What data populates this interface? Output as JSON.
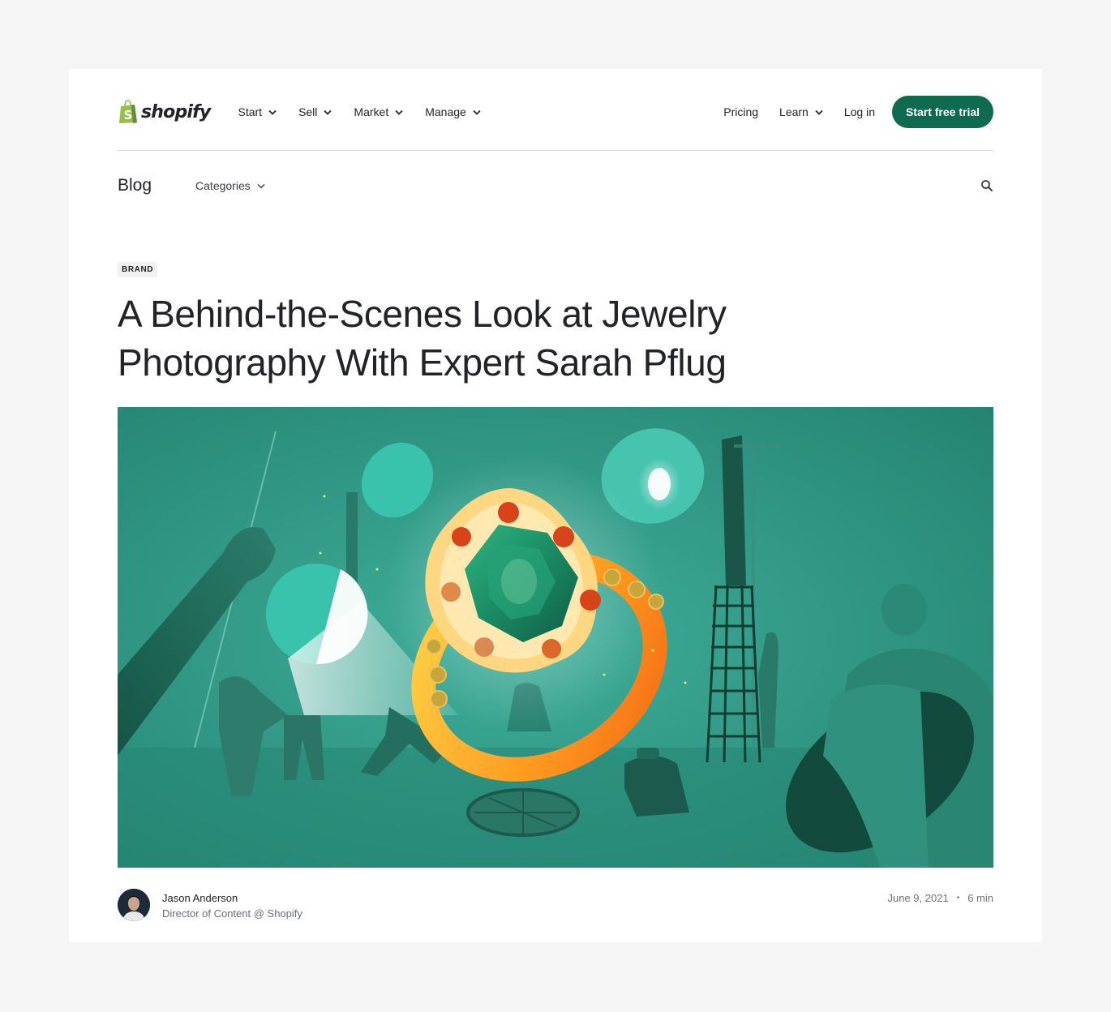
{
  "brand": {
    "name": "shopify",
    "accent_color": "#0e6b4f",
    "logo_color": "#95bf47"
  },
  "nav": {
    "left_items": [
      {
        "label": "Start",
        "has_dropdown": true
      },
      {
        "label": "Sell",
        "has_dropdown": true
      },
      {
        "label": "Market",
        "has_dropdown": true
      },
      {
        "label": "Manage",
        "has_dropdown": true
      }
    ],
    "right_items": [
      {
        "label": "Pricing",
        "has_dropdown": false
      },
      {
        "label": "Learn",
        "has_dropdown": true
      },
      {
        "label": "Log in",
        "has_dropdown": false
      }
    ],
    "cta_label": "Start free trial"
  },
  "blog_bar": {
    "title": "Blog",
    "categories_label": "Categories",
    "search_icon": "search-icon"
  },
  "article": {
    "category_badge": "BRAND",
    "title": "A Behind-the-Scenes Look at Jewelry Photography With Expert Sarah Pflug",
    "hero_image_alt": "Illustration of a photo studio crew lighting a giant gold ring with an emerald",
    "author": {
      "name": "Jason Anderson",
      "role": "Director of Content @ Shopify"
    },
    "date": "June 9, 2021",
    "separator": "•",
    "read_time": "6 min"
  }
}
